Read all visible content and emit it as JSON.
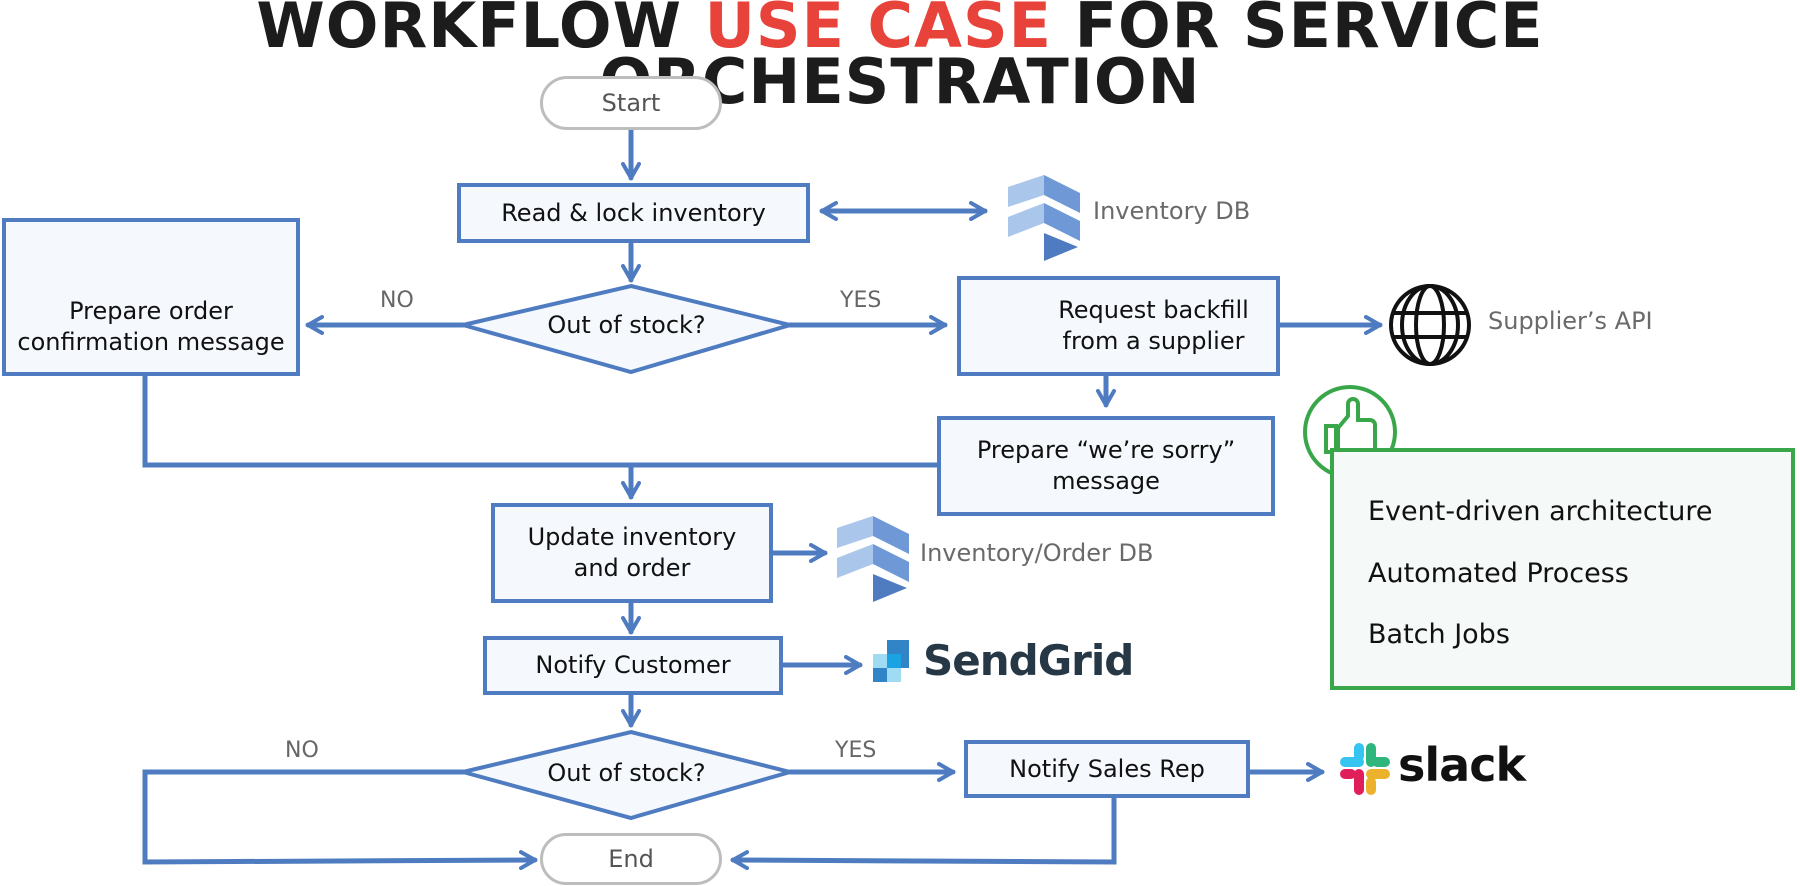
{
  "title": {
    "part1": "WORKFLOW ",
    "accent": "USE CASE",
    "part2": " FOR SERVICE ORCHESTRATION",
    "accent_color": "#e8433a"
  },
  "colors": {
    "flow_blue": "#4f7cc1",
    "box_fill": "#f5f9fd",
    "benefit_green": "#3aa64a",
    "terminal_border": "#bdbdbd"
  },
  "nodes": {
    "start": "Start",
    "read_lock": "Read & lock inventory",
    "decision1": "Out of stock?",
    "prepare_confirmation_line1": "Prepare order",
    "prepare_confirmation_line2": "confirmation message",
    "request_backfill_line1": "Request backfill",
    "request_backfill_line2": "from a supplier",
    "prepare_sorry_line1": "Prepare “we’re sorry”",
    "prepare_sorry_line2": "message",
    "update_line1": "Update inventory",
    "update_line2": "and order",
    "notify_customer": "Notify Customer",
    "decision2": "Out of stock?",
    "notify_sales": "Notify Sales Rep",
    "end": "End"
  },
  "edge_labels": {
    "d1_no": "NO",
    "d1_yes": "YES",
    "d2_no": "NO",
    "d2_yes": "YES"
  },
  "externals": {
    "inventory_db": "Inventory DB",
    "suppliers_api": "Supplier’s API",
    "inventory_order_db": "Inventory/Order DB",
    "sendgrid": "SendGrid",
    "slack": "slack"
  },
  "icons": {
    "functions": "cloud-functions-icon",
    "workflows": "workflows-icon",
    "database": "firestore-icon",
    "globe": "globe-icon",
    "thumbs_up": "thumbs-up-icon",
    "sendgrid_logo": "sendgrid-logo-icon",
    "slack_logo": "slack-logo-icon"
  },
  "benefits": {
    "items": [
      "Event-driven architecture",
      "Automated Process",
      "Batch Jobs"
    ]
  }
}
